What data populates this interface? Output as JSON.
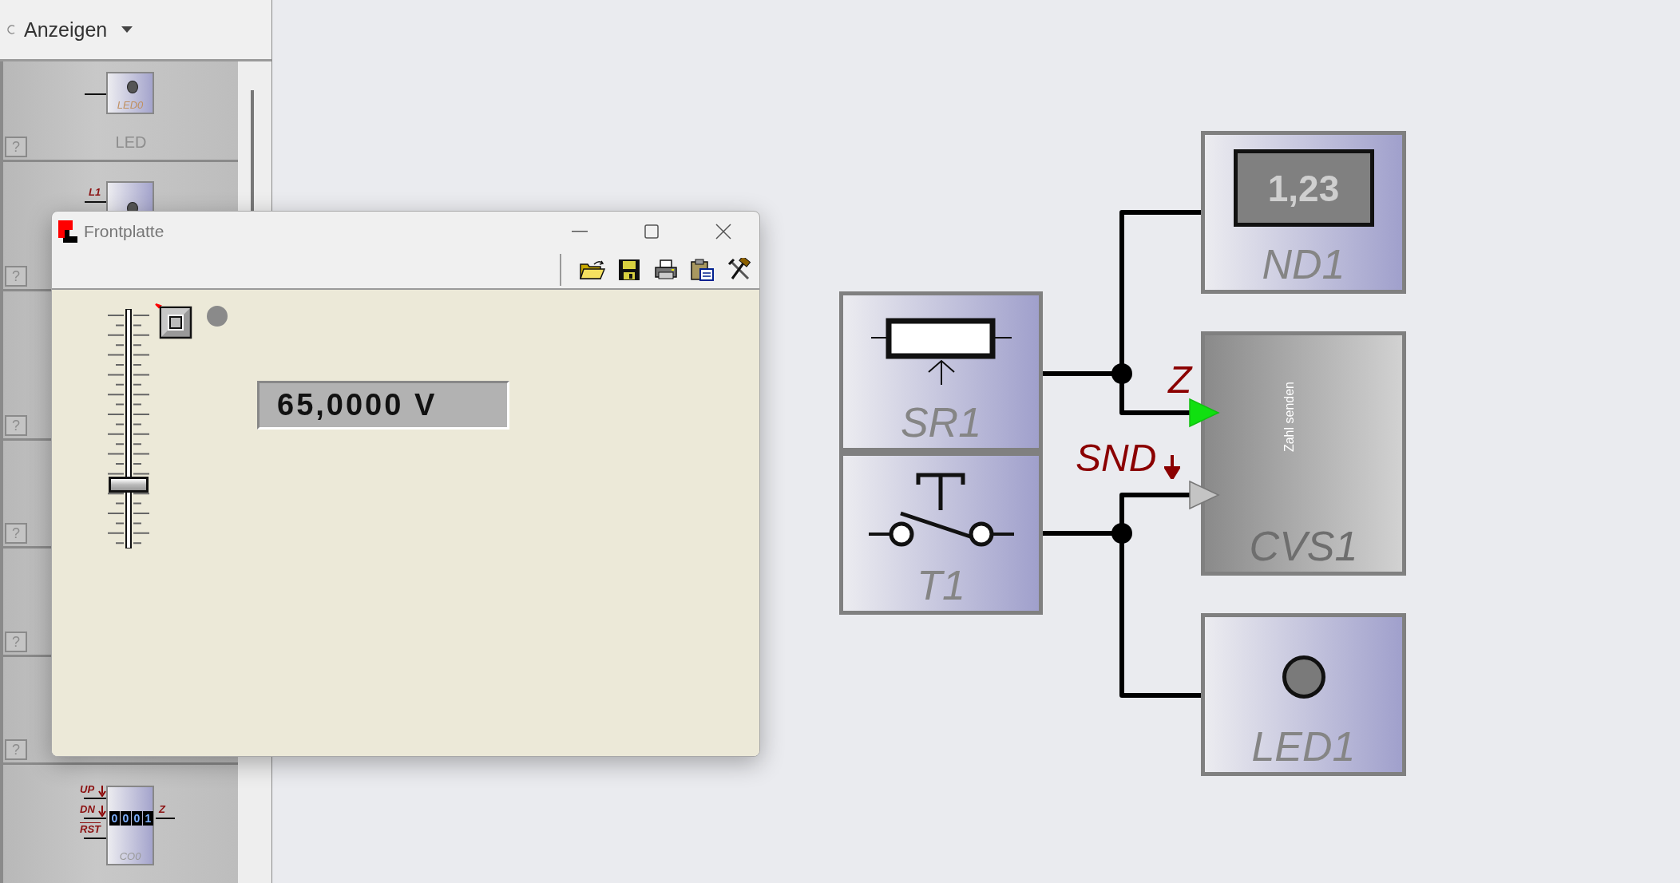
{
  "palette": {
    "view_menu": {
      "label": "Anzeigen"
    },
    "items": [
      {
        "kind": "led",
        "symbol_label": "LED0",
        "name": "LED",
        "help": "?"
      },
      {
        "kind": "led_pin",
        "pin_label": "L1",
        "help": "?"
      },
      {
        "kind": "blank",
        "help": "?"
      },
      {
        "kind": "blank",
        "help": "?"
      },
      {
        "kind": "blank",
        "help": "?"
      },
      {
        "kind": "blank",
        "help": "?"
      },
      {
        "kind": "counter",
        "inputs": [
          {
            "label": "UP",
            "edge": true,
            "inverted": false
          },
          {
            "label": "DN",
            "edge": true,
            "inverted": false
          },
          {
            "label": "RST",
            "edge": false,
            "inverted": true
          }
        ],
        "digits": [
          "0",
          "0",
          "0",
          "1"
        ],
        "output": "Z",
        "symbol_label": "CO0"
      }
    ]
  },
  "front_panel": {
    "title": "Frontplatte",
    "slider": {
      "level": 0.25
    },
    "lamp": {
      "on": false
    },
    "display": "65,0000 V"
  },
  "diagram": {
    "blocks": [
      {
        "kind": "potentiometer",
        "name": "SR1"
      },
      {
        "kind": "pushbutton",
        "name": "T1"
      },
      {
        "kind": "number_display",
        "name": "ND1",
        "value": "1,23"
      },
      {
        "kind": "number_sender",
        "name": "CVS1",
        "caption": "Zahl senden"
      },
      {
        "kind": "led",
        "name": "LED1",
        "on": false
      }
    ],
    "inputs": [
      {
        "label": "Z",
        "edge": false,
        "active": true
      },
      {
        "label": "SND",
        "edge": true,
        "active": false
      }
    ]
  }
}
